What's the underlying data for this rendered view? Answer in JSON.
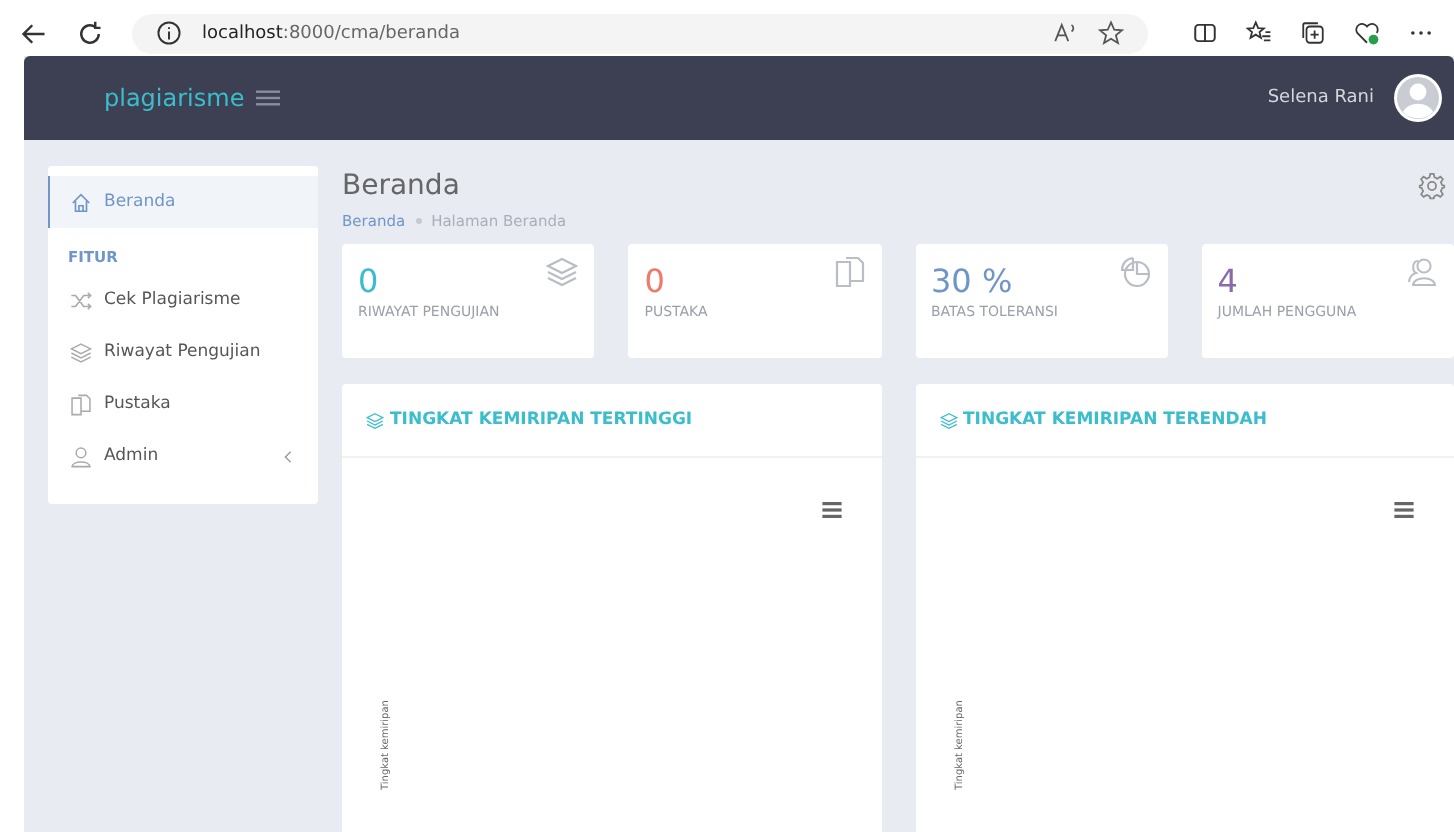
{
  "browser": {
    "url_host": "localhost",
    "url_path": ":8000/cma/beranda"
  },
  "header": {
    "brand": "plagiarisme",
    "user": "Selena Rani"
  },
  "sidebar": {
    "items": [
      {
        "label": "Beranda",
        "kind": "home",
        "selected": true
      }
    ],
    "section": "FITUR",
    "features": [
      {
        "label": "Cek Plagiarisme",
        "kind": "shuffle",
        "expandable": false
      },
      {
        "label": "Riwayat Pengujian",
        "kind": "layers",
        "expandable": false
      },
      {
        "label": "Pustaka",
        "kind": "copy",
        "expandable": false
      },
      {
        "label": "Admin",
        "kind": "user",
        "expandable": true
      }
    ]
  },
  "page": {
    "title": "Beranda",
    "breadcrumb": [
      "Beranda",
      "Halaman Beranda"
    ]
  },
  "stats": [
    {
      "value": "0",
      "label": "RIWAYAT PENGUJIAN",
      "kind": "layers",
      "color": "#3bbdcc"
    },
    {
      "value": "0",
      "label": "PUSTAKA",
      "kind": "copy",
      "color": "#f07a6a"
    },
    {
      "value": "30 %",
      "label": "BATAS TOLERANSI",
      "kind": "pie",
      "color": "#6f96c8"
    },
    {
      "value": "4",
      "label": "JUMLAH PENGGUNA",
      "kind": "users",
      "color": "#8a6aa8"
    }
  ],
  "panels": [
    {
      "title": "TINGKAT KEMIRIPAN TERTINGGI",
      "axis_label": "Tingkat kemiripan"
    },
    {
      "title": "TINGKAT KEMIRIPAN TERENDAH",
      "axis_label": "Tingkat kemiripan"
    }
  ]
}
